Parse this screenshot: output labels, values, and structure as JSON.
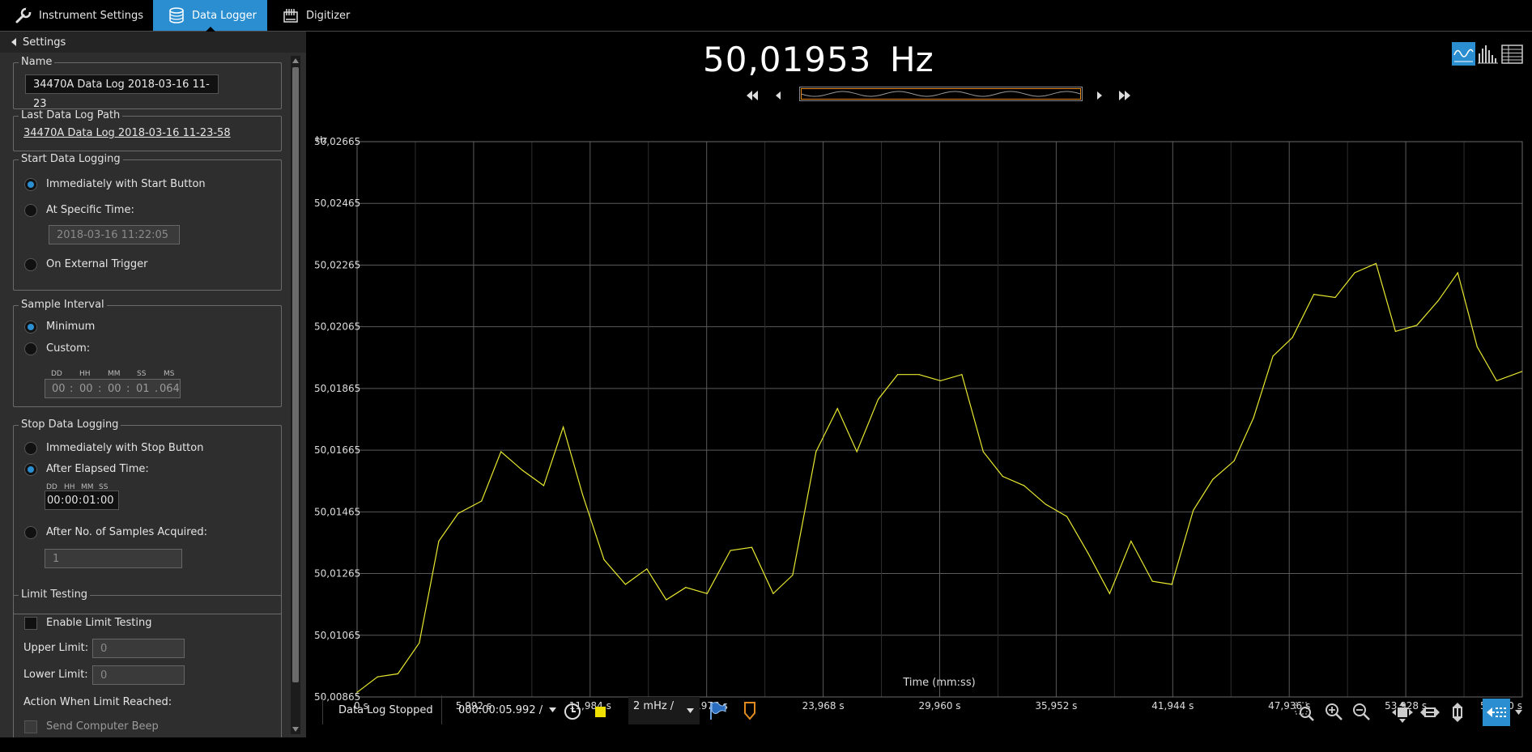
{
  "tabs": [
    {
      "label": "Instrument Settings",
      "icon": "wrench-icon"
    },
    {
      "label": "Data Logger",
      "icon": "database-icon",
      "active": true
    },
    {
      "label": "Digitizer",
      "icon": "digitizer-icon"
    }
  ],
  "settings": {
    "header": "Settings",
    "name": {
      "title": "Name",
      "value": "34470A Data Log 2018-03-16 11-23"
    },
    "last_path": {
      "title": "Last Data Log Path",
      "value": "34470A Data Log 2018-03-16 11-23-58"
    },
    "start": {
      "title": "Start Data Logging",
      "opt_immediate": "Immediately with Start Button",
      "opt_specific": "At Specific Time:",
      "specific_value": "2018-03-16 11:22:05",
      "opt_external": "On External Trigger",
      "selected": "immediate"
    },
    "interval": {
      "title": "Sample Interval",
      "opt_min": "Minimum",
      "opt_custom": "Custom:",
      "heads": [
        "DD",
        "HH",
        "MM",
        "SS",
        "MS"
      ],
      "values": [
        "00",
        "00",
        "00",
        "01",
        "064"
      ],
      "seps": [
        ":",
        ":",
        ":",
        "."
      ],
      "selected": "minimum"
    },
    "stop": {
      "title": "Stop Data Logging",
      "opt_immediate": "Immediately with Stop Button",
      "opt_elapsed": "After Elapsed Time:",
      "heads": [
        "DD",
        "HH",
        "MM",
        "SS"
      ],
      "values": [
        "00",
        "00",
        "01",
        "00"
      ],
      "opt_samples": "After No. of Samples Acquired:",
      "samples_value": "1",
      "selected": "elapsed"
    },
    "limit": {
      "title": "Limit Testing",
      "enable": "Enable Limit Testing",
      "upper_label": "Upper Limit:",
      "upper_value": "0",
      "lower_label": "Lower Limit:",
      "lower_value": "0",
      "action_label": "Action When Limit Reached:",
      "beep_label": "Send Computer Beep"
    }
  },
  "readout": {
    "value": "50,01953",
    "unit": "Hz"
  },
  "status": {
    "state": "Data Log Stopped",
    "time_scale": "000:00:05.992 /",
    "amp_scale": "2 mHz /"
  },
  "colors": {
    "accent": "#2a8ed0",
    "trace": "#e8e830",
    "marker": "#e08a20"
  },
  "chart_data": {
    "type": "line",
    "title": "",
    "xlabel": "Time (mm:ss)",
    "ylabel": "Hz",
    "xlim": [
      0,
      59920
    ],
    "ylim": [
      50.00865,
      50.02665
    ],
    "x_tick_values": [
      0,
      5992,
      11984,
      17976,
      23968,
      29960,
      35952,
      41944,
      47936,
      53928,
      59920
    ],
    "x_tick_labels": [
      "0 s",
      "5,992 s",
      "11,984 s",
      "17,976 s",
      "23,968 s",
      "29,960 s",
      "35,952 s",
      "41,944 s",
      "47,936 s",
      "53,928 s",
      "59,920 s"
    ],
    "y_tick_values": [
      50.00865,
      50.01065,
      50.01265,
      50.01465,
      50.01665,
      50.01865,
      50.02065,
      50.02265,
      50.02465,
      50.02665
    ],
    "y_tick_labels": [
      "50,00865",
      "50,01065",
      "50,01265",
      "50,01465",
      "50,01665",
      "50,01865",
      "50,02065",
      "50,02265",
      "50,02465",
      "50,02665"
    ],
    "grid": true,
    "series": [
      {
        "x": [
          0,
          1050,
          2100,
          3200,
          4200,
          5200,
          6400,
          7400,
          8500,
          9600,
          10600,
          11600,
          12700,
          13800,
          14900,
          15900,
          16900,
          18000,
          19200,
          20300,
          21400,
          22400,
          23600,
          24700,
          25700,
          26800,
          27800,
          28900,
          30000,
          31100,
          32200,
          33200,
          34300,
          35400,
          36500,
          37600,
          38700,
          39800,
          40900,
          41900,
          43000,
          44000,
          45100,
          46100,
          47100,
          48100,
          49200,
          50300,
          51300,
          52400,
          53400,
          54500,
          55600,
          56600,
          57600,
          58600,
          59900
        ],
        "y": [
          50.0088,
          50.0093,
          50.0094,
          50.0104,
          50.0137,
          50.0146,
          50.015,
          50.0166,
          50.016,
          50.0155,
          50.0174,
          50.0152,
          50.0131,
          50.0123,
          50.0128,
          50.0118,
          50.0122,
          50.012,
          50.0134,
          50.0135,
          50.012,
          50.0126,
          50.0166,
          50.018,
          50.0166,
          50.0183,
          50.0191,
          50.0191,
          50.0189,
          50.0191,
          50.0166,
          50.0158,
          50.0155,
          50.0149,
          50.0145,
          50.0133,
          50.012,
          50.0137,
          50.0124,
          50.0123,
          50.0147,
          50.0157,
          50.0163,
          50.0177,
          50.0197,
          50.0203,
          50.0217,
          50.0216,
          50.0224,
          50.0227,
          50.0205,
          50.0207,
          50.0215,
          50.0224,
          50.02,
          50.0189,
          50.0192
        ]
      }
    ]
  }
}
